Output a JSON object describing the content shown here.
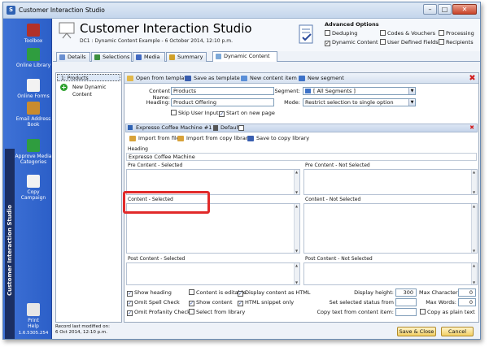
{
  "window": {
    "title": "Customer Interaction Studio",
    "app_icon": "S",
    "buttons": [
      "–",
      "□",
      "✕"
    ]
  },
  "sidebar": {
    "vertical_title": "Customer Interaction Studio",
    "items": [
      {
        "label": "Toolbox",
        "icon": "toolbox-icon",
        "color": "#b2312a"
      },
      {
        "label": "Online Library",
        "icon": "library-icon",
        "color": "#2f9d3f"
      },
      {
        "label": "Online Forms",
        "icon": "forms-icon",
        "color": "#f2f2f2"
      },
      {
        "label": "Email Address Book",
        "icon": "address-book-icon",
        "color": "#c98b2e"
      },
      {
        "label": "Approve Media Categories",
        "icon": "approve-icon",
        "color": "#2f9d3f"
      },
      {
        "label": "Copy Campaign",
        "icon": "copy-icon",
        "color": "#f2f2f2"
      },
      {
        "label": "Print",
        "icon": "print-icon",
        "color": "#e6e6e6"
      },
      {
        "label": "Help",
        "icon": "help-icon",
        "color": "#e6e6e6"
      }
    ],
    "version": "1.6.5305.254"
  },
  "header": {
    "title": "Customer Interaction Studio",
    "subtitle": "DC1 : Dynamic Content Example - 6 October 2014, 12:10 p.m.",
    "advanced_options": {
      "title": "Advanced Options",
      "options": [
        {
          "label": "Deduping",
          "checked": false
        },
        {
          "label": "Dynamic Content",
          "checked": true
        },
        {
          "label": "Codes & Vouchers",
          "checked": false
        },
        {
          "label": "User Defined Fields",
          "checked": false
        },
        {
          "label": "Processing",
          "checked": false
        },
        {
          "label": "Recipients",
          "checked": false
        }
      ]
    }
  },
  "tabs": [
    {
      "label": "Details",
      "icon": "details-icon",
      "active": false
    },
    {
      "label": "Selections",
      "icon": "selections-icon",
      "active": false
    },
    {
      "label": "Media",
      "icon": "media-icon",
      "active": false
    },
    {
      "label": "Summary",
      "icon": "summary-icon",
      "active": false
    },
    {
      "label": "Dynamic Content",
      "icon": "dynamic-content-icon",
      "active": true
    }
  ],
  "left_panel": {
    "items": [
      "1: Products",
      "New Dynamic Content"
    ]
  },
  "toolbar": {
    "open_template": "Open from template",
    "save_template": "Save as template",
    "new_content_item": "New content item",
    "new_segment": "New segment",
    "close": "✖"
  },
  "form": {
    "content_name_label": "Content Name:",
    "content_name_value": "Products",
    "heading_label": "Heading:",
    "heading_value": "Product Offering",
    "segment_label": "Segment:",
    "segment_value": "[ All Segments ]",
    "mode_label": "Mode:",
    "mode_value": "Restrict selection to single option",
    "skip_user_input": "Skip User Input",
    "start_new_page": "Start on new page",
    "skip_checked": false,
    "start_checked": true
  },
  "item": {
    "title": "Expresso Coffee Machine #1",
    "default_label": "Default:",
    "import_file": "Import from file",
    "import_library": "Import from copy library",
    "save_library": "Save to copy library",
    "heading_label": "Heading",
    "heading_value": "Expresso Coffee Machine",
    "pre_selected": "Pre Content - Selected",
    "pre_not_selected": "Pre Content - Not Selected",
    "content_selected": "Content - Selected",
    "content_not_selected": "Content - Not Selected",
    "post_selected": "Post Content - Selected",
    "post_not_selected": "Post Content - Not Selected"
  },
  "options": {
    "show_heading": "Show heading",
    "omit_spell": "Omit Spell Check",
    "omit_profanity": "Omit Profanity Check",
    "content_editable": "Content is editable",
    "show_content": "Show content",
    "select_from_library": "Select from library",
    "display_html": "Display content as HTML",
    "html_snippet": "HTML snippet only",
    "display_height_label": "Display height:",
    "display_height_value": "300",
    "set_selected_status": "Set selected status from",
    "copy_text_label": "Copy text from content item:",
    "max_chars_label": "Max Characters:",
    "max_chars_value": "0",
    "max_words_label": "Max Words:",
    "max_words_value": "0",
    "copy_plain": "Copy as plain text"
  },
  "footer": {
    "status_line1": "Record last modified on:",
    "status_line2": "6 Oct 2014, 12:10 p.m.",
    "save_close": "Save & Close",
    "cancel": "Cancel"
  },
  "colors": {
    "sidebar_blue": "#2c5fc8",
    "highlight_red": "#e12a2a",
    "button_gold": "#f2cf64"
  }
}
